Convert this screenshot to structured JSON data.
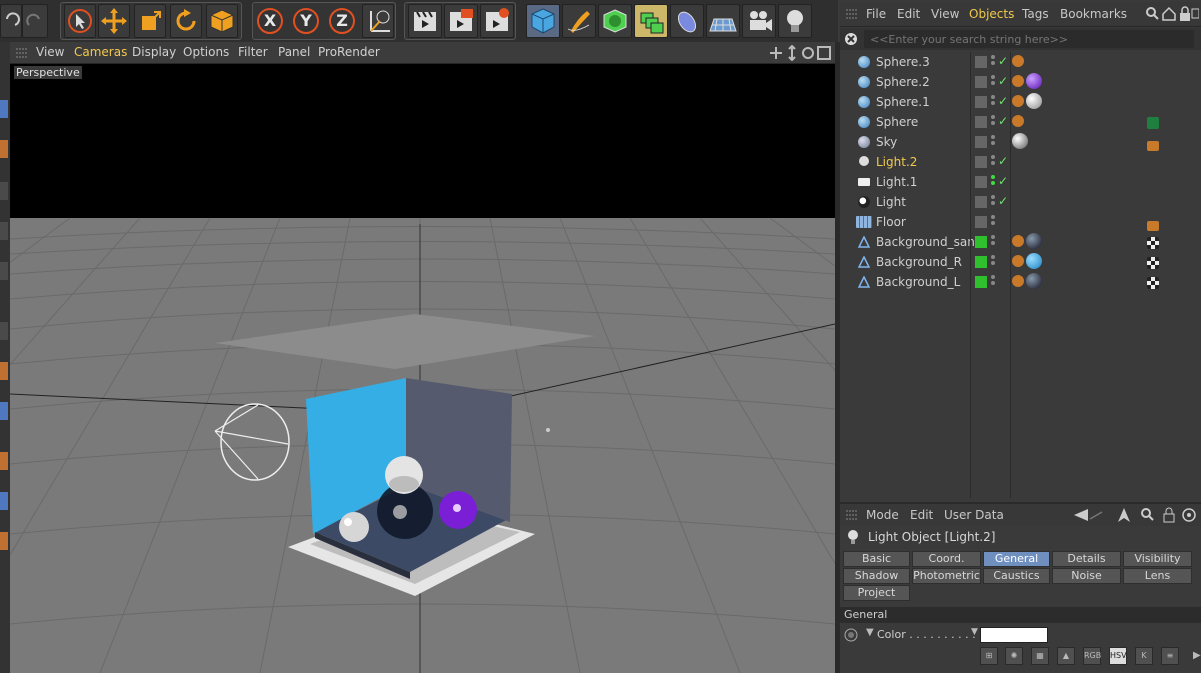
{
  "toolbar": {
    "axis_x": "X",
    "axis_y": "Y",
    "axis_z": "Z"
  },
  "viewport": {
    "menu": [
      "View",
      "Cameras",
      "Display",
      "Options",
      "Filter",
      "Panel",
      "ProRender"
    ],
    "selected_menu": "Cameras",
    "label": "Perspective"
  },
  "objects_panel": {
    "menu": [
      "File",
      "Edit",
      "View",
      "Objects",
      "Tags",
      "Bookmarks"
    ],
    "selected_menu": "Objects",
    "search_placeholder": "<<Enter your search string here>>",
    "items": [
      {
        "name": "Sphere.3",
        "icon": "sphere-icon"
      },
      {
        "name": "Sphere.2",
        "icon": "sphere-icon"
      },
      {
        "name": "Sphere.1",
        "icon": "sphere-icon"
      },
      {
        "name": "Sphere",
        "icon": "sphere-icon"
      },
      {
        "name": "Sky",
        "icon": "sky-icon"
      },
      {
        "name": "Light.2",
        "icon": "light-bulb-icon"
      },
      {
        "name": "Light.1",
        "icon": "area-light-icon"
      },
      {
        "name": "Light",
        "icon": "spot-light-icon"
      },
      {
        "name": "Floor",
        "icon": "floor-icon"
      },
      {
        "name": "Background_sand",
        "icon": "polygon-icon"
      },
      {
        "name": "Background_R",
        "icon": "polygon-icon"
      },
      {
        "name": "Background_L",
        "icon": "polygon-icon"
      }
    ],
    "selected_item": "Light.2"
  },
  "attributes": {
    "menu": [
      "Mode",
      "Edit",
      "User Data"
    ],
    "title": "Light Object [Light.2]",
    "tabs_row1": [
      "Basic",
      "Coord.",
      "General",
      "Details",
      "Visibility"
    ],
    "tabs_row2": [
      "Shadow",
      "Photometric",
      "Caustics",
      "Noise",
      "Lens"
    ],
    "tabs_row3": [
      "Project"
    ],
    "selected_tab": "General",
    "section": "General",
    "color_label": "Color . . . . . . . . . .",
    "color_value": "#ffffff",
    "color_modes": [
      "RGB",
      "HSV",
      "K"
    ]
  },
  "colors": {
    "accent": "#f2c94c",
    "blue_wall": "#35aee6",
    "purple_sphere": "#7a1fd6"
  }
}
